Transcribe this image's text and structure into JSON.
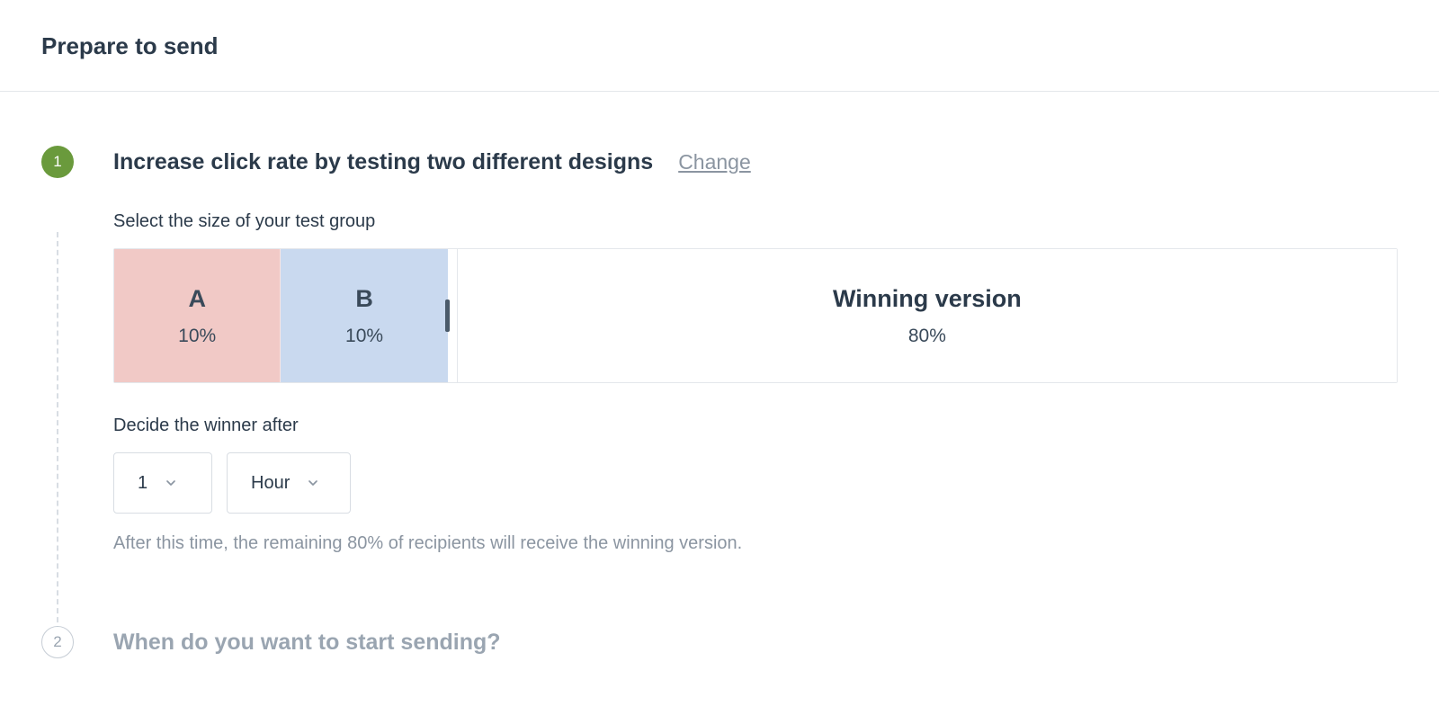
{
  "header": {
    "title": "Prepare to send"
  },
  "steps": {
    "step1": {
      "number": "1",
      "title": "Increase click rate by testing two different designs",
      "change_link": "Change",
      "test_group": {
        "label": "Select the size of your test group",
        "segment_a": {
          "letter": "A",
          "percent": "10%"
        },
        "segment_b": {
          "letter": "B",
          "percent": "10%"
        },
        "segment_winner": {
          "title": "Winning version",
          "percent": "80%"
        }
      },
      "winner_timing": {
        "label": "Decide the winner after",
        "count_value": "1",
        "unit_value": "Hour",
        "helper": "After this time, the remaining 80% of recipients will receive the winning version."
      }
    },
    "step2": {
      "number": "2",
      "title": "When do you want to start sending?"
    }
  }
}
